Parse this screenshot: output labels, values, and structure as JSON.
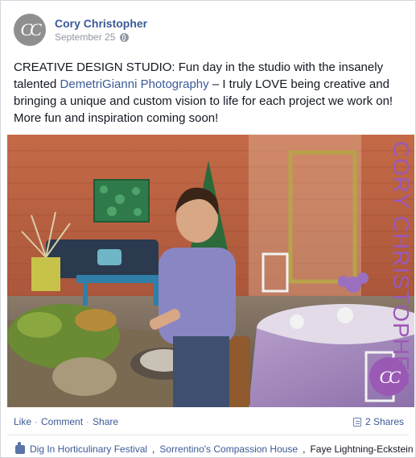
{
  "post": {
    "author": "Cory Christopher",
    "avatar_initials": "CC",
    "date": "September 25",
    "privacy_icon": "globe-icon",
    "text_before_link": "CREATIVE DESIGN STUDIO: Fun day in the studio with the insanely talented ",
    "tagged_link": "DemetriGianni Photography",
    "text_after_link": " – I truly LOVE being creative and bringing a unique and custom vision to life for each project we work on! More fun and inspiration coming soon!",
    "photo": {
      "watermark_text": "CORY CHRISTOPHER",
      "watermark_logo": "CC"
    }
  },
  "actions": {
    "like": "Like",
    "comment": "Comment",
    "share": "Share",
    "separator": "·",
    "shares_count": "2 Shares"
  },
  "likers": {
    "items": [
      "Dig In Horticulinary Festival",
      "Sorrentino's Compassion House",
      "Faye Lightning-Eckstein"
    ],
    "separator": ","
  },
  "colors": {
    "link": "#3b5998",
    "watermark": "#9b59b6"
  }
}
